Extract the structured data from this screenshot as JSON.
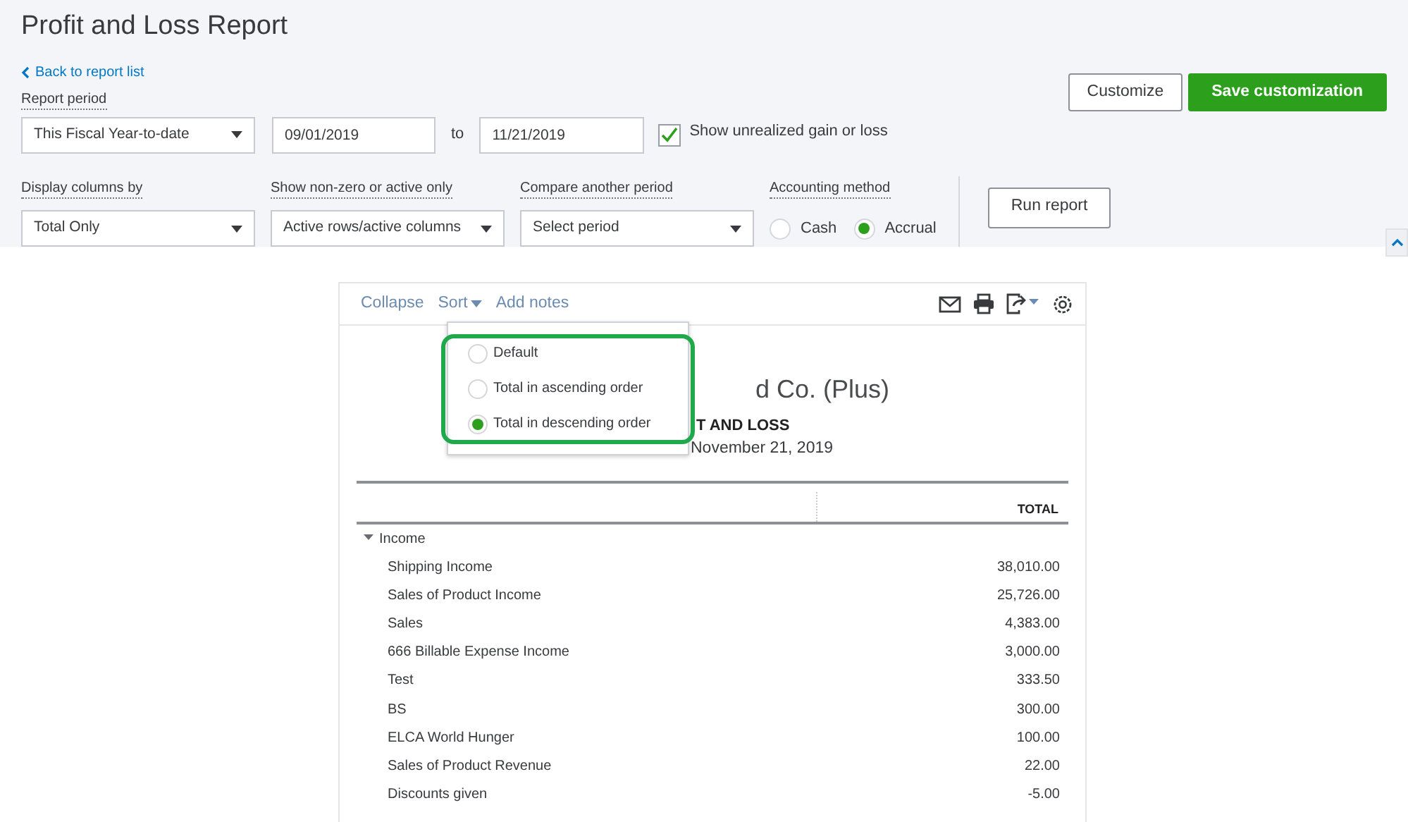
{
  "title": "Profit and Loss Report",
  "back_link": "Back to report list",
  "report_period": {
    "label": "Report period",
    "preset": "This Fiscal Year-to-date",
    "from": "09/01/2019",
    "to_label": "to",
    "to": "11/21/2019",
    "unrealized": {
      "label": "Show unrealized gain or loss",
      "checked": true
    }
  },
  "filters": [
    {
      "label": "Display columns by",
      "value": "Total Only"
    },
    {
      "label": "Show non-zero or active only",
      "value": "Active rows/active columns"
    },
    {
      "label": "Compare another period",
      "value": "Select period"
    }
  ],
  "accounting_method": {
    "label": "Accounting method",
    "options": [
      {
        "label": "Cash",
        "selected": false
      },
      {
        "label": "Accrual",
        "selected": true
      }
    ]
  },
  "buttons": {
    "customize": "Customize",
    "save": "Save customization",
    "run": "Run report"
  },
  "report": {
    "toolbar": [
      {
        "label": "Collapse",
        "dropdown": false
      },
      {
        "label": "Sort",
        "dropdown": true
      },
      {
        "label": "Add notes",
        "dropdown": false
      }
    ],
    "sort_menu": [
      {
        "label": "Default",
        "selected": false
      },
      {
        "label": "Total in ascending order",
        "selected": false
      },
      {
        "label": "Total in descending order",
        "selected": true
      }
    ],
    "company": "d Co. (Plus)",
    "report_title": "T AND LOSS",
    "date_range": "November 21, 2019",
    "column": "TOTAL",
    "section": {
      "label": "Income",
      "expanded": true,
      "rows": [
        {
          "name": "Shipping Income",
          "total": "38,010.00"
        },
        {
          "name": "Sales of Product Income",
          "total": "25,726.00"
        },
        {
          "name": "Sales",
          "total": "4,383.00"
        },
        {
          "name": "666 Billable Expense Income",
          "total": "3,000.00"
        },
        {
          "name": "Test",
          "total": "333.50"
        },
        {
          "name": "BS",
          "total": "300.00"
        },
        {
          "name": "ELCA World Hunger",
          "total": "100.00"
        },
        {
          "name": "Sales of Product Revenue",
          "total": "22.00"
        },
        {
          "name": "Discounts given",
          "total": "-5.00"
        }
      ]
    }
  }
}
